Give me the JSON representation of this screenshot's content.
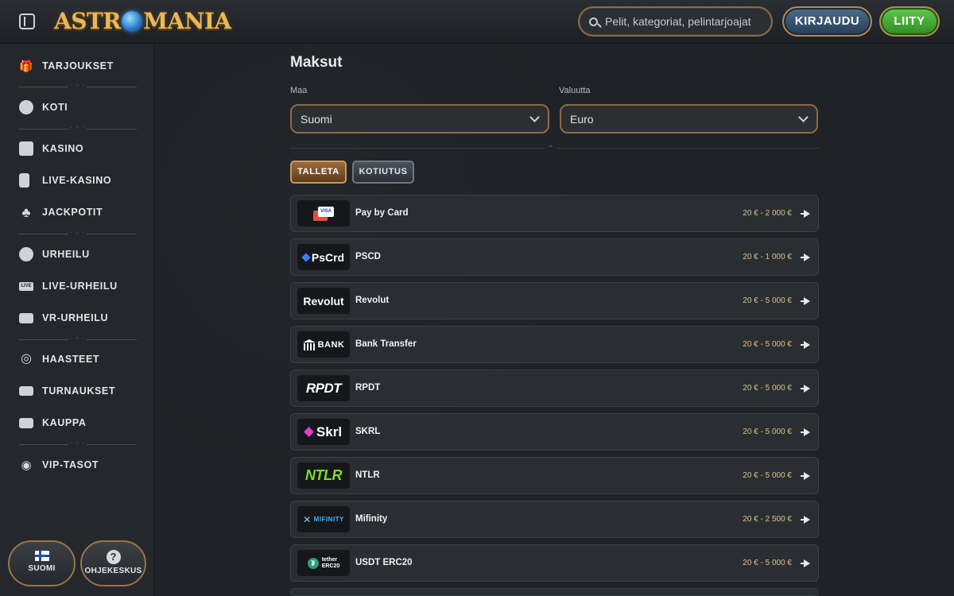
{
  "header": {
    "logo": {
      "before": "ASTR",
      "after": "MANIA"
    },
    "search_placeholder": "Pelit, kategoriat, pelintarjoajat",
    "login_label": "KIRJAUDU",
    "join_label": "LIITY",
    "accent_color": "#8e6b41"
  },
  "sidebar": {
    "items": [
      {
        "label": "TARJOUKSET",
        "icon": "gift-icon"
      },
      {
        "label": "KOTI",
        "icon": "home-icon"
      },
      {
        "label": "KASINO",
        "icon": "slot-machine-icon"
      },
      {
        "label": "LIVE-KASINO",
        "icon": "playing-card-icon"
      },
      {
        "label": "JACKPOTIT",
        "icon": "clover-icon"
      },
      {
        "label": "URHEILU",
        "icon": "soccer-ball-icon"
      },
      {
        "label": "LIVE-URHEILU",
        "icon": "live-badge-icon",
        "badge": "LIVE"
      },
      {
        "label": "VR-URHEILU",
        "icon": "vr-icon"
      },
      {
        "label": "HAASTEET",
        "icon": "target-icon"
      },
      {
        "label": "TURNAUKSET",
        "icon": "podium-icon"
      },
      {
        "label": "KAUPPA",
        "icon": "chest-icon"
      },
      {
        "label": "VIP-TASOT",
        "icon": "vip-gem-icon"
      }
    ],
    "language_label": "SUOMI",
    "help_label": "OHJEKESKUS",
    "help_glyph": "?"
  },
  "main": {
    "title": "Maksut",
    "country_label": "Maa",
    "country_value": "Suomi",
    "currency_label": "Valuutta",
    "currency_value": "Euro",
    "tabs": [
      {
        "label": "TALLETA",
        "active": true
      },
      {
        "label": "KOTIUTUS",
        "active": false
      }
    ],
    "methods": [
      {
        "name": "Pay by Card",
        "range": "20 € - 2 000 €",
        "logo": "card",
        "logo_text": "VISA"
      },
      {
        "name": "PSCD",
        "range": "20 € - 1 000 €",
        "logo": "pscd",
        "logo_text": "PsCrd"
      },
      {
        "name": "Revolut",
        "range": "20 € - 5 000 €",
        "logo": "revolut",
        "logo_text": "Revolut"
      },
      {
        "name": "Bank Transfer",
        "range": "20 € - 5 000 €",
        "logo": "bank",
        "logo_text": "BANK"
      },
      {
        "name": "RPDT",
        "range": "20 € - 5 000 €",
        "logo": "rpdt",
        "logo_text": "RPDT"
      },
      {
        "name": "SKRL",
        "range": "20 € - 5 000 €",
        "logo": "skrl",
        "logo_text": "Skrl"
      },
      {
        "name": "NTLR",
        "range": "20 € - 5 000 €",
        "logo": "ntlr",
        "logo_text": "NTLR"
      },
      {
        "name": "Mifinity",
        "range": "20 € - 2 500 €",
        "logo": "mifinity",
        "logo_text": "MIFINITY"
      },
      {
        "name": "USDT ERC20",
        "range": "20 € - 5 000 €",
        "logo": "tether",
        "logo_text": "tether",
        "logo_subtext": "ERC20"
      }
    ]
  }
}
